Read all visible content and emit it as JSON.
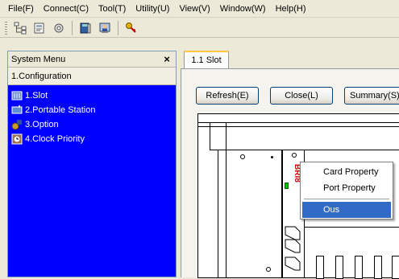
{
  "menubar": {
    "items": [
      {
        "label": "File(F)"
      },
      {
        "label": "Connect(C)"
      },
      {
        "label": "Tool(T)"
      },
      {
        "label": "Utility(U)"
      },
      {
        "label": "View(V)"
      },
      {
        "label": "Window(W)"
      },
      {
        "label": "Help(H)"
      }
    ]
  },
  "toolbar": {
    "icons": [
      "hierarchy-icon",
      "document-icon",
      "gear-icon",
      "book-icon",
      "person-icon",
      "key-icon"
    ]
  },
  "left_panel": {
    "title": "System Menu",
    "close": "×",
    "section": "1.Configuration",
    "items": [
      {
        "label": "1.Slot",
        "icon": "slot-icon",
        "color": "#6a8ccf"
      },
      {
        "label": "2.Portable Station",
        "icon": "portable-station-icon",
        "color": "#5f8fd0"
      },
      {
        "label": "3.Option",
        "icon": "option-icon",
        "color": "#c8a020"
      },
      {
        "label": "4.Clock Priority",
        "icon": "clock-priority-icon",
        "color": "#9a7050"
      }
    ]
  },
  "tab": {
    "label": "1.1 Slot"
  },
  "buttons": {
    "refresh": "Refresh(E)",
    "close": "Close(L)",
    "summary": "Summary(S)"
  },
  "card": {
    "label": "BRI8"
  },
  "context_menu": {
    "items": [
      {
        "label": "Card Property"
      },
      {
        "label": "Port Property"
      },
      {
        "label": "Ous"
      }
    ]
  },
  "colors": {
    "panel_background": "#0000ff",
    "menu_selection": "#316ac5",
    "card_label": "#d00000",
    "tab_accent": "#ffc83c"
  }
}
